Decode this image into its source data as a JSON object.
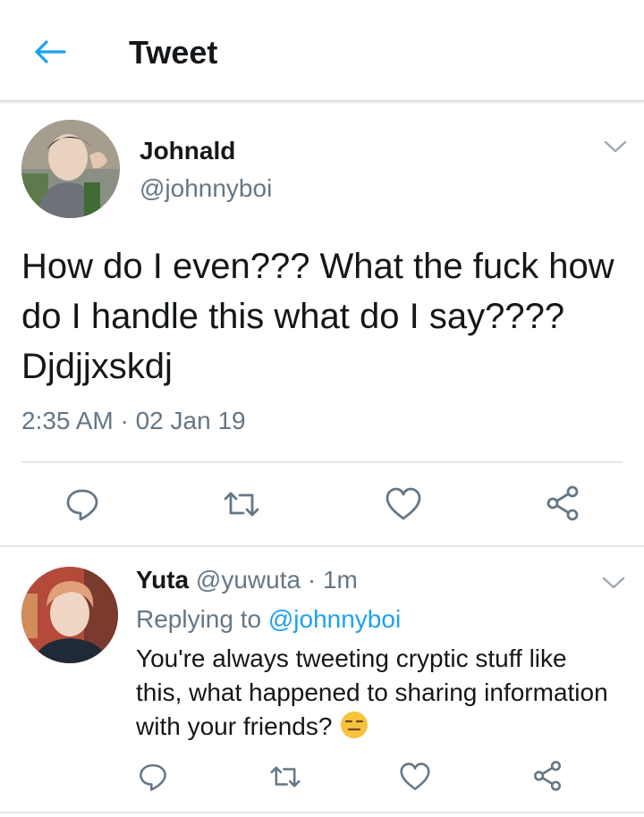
{
  "header": {
    "title": "Tweet",
    "back_icon": "arrow-left-icon"
  },
  "main_tweet": {
    "author_name": "Johnald",
    "author_handle": "@johnnyboi",
    "text": "How do I even??? What the fuck how do I handle this what do I say???? Djdjjxskdj",
    "timestamp": "2:35 AM · 02 Jan 19",
    "actions": [
      "reply-icon",
      "retweet-icon",
      "like-icon",
      "share-icon"
    ]
  },
  "reply_tweet": {
    "author_name": "Yuta",
    "author_handle": "@yuwuta",
    "separator": " · ",
    "age": "1m",
    "replying_prefix": "Replying to ",
    "replying_to": "@johnnyboi",
    "text": "You're always tweeting cryptic stuff like this, what happened to sharing information with your friends?",
    "emoji": "expressionless-face-emoji",
    "actions": [
      "reply-icon",
      "retweet-icon",
      "like-icon",
      "share-icon"
    ]
  },
  "colors": {
    "accent": "#1da1f2",
    "text": "#14171a",
    "secondary": "#657786",
    "divider": "#e1e8ed",
    "icon": "#657786"
  }
}
